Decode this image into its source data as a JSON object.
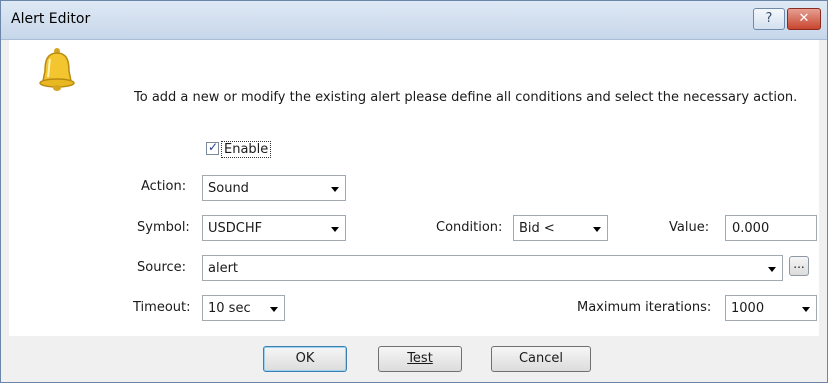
{
  "window": {
    "title": "Alert Editor",
    "help_label": "?",
    "close_label": "✕"
  },
  "intro": "To add a new or modify the existing alert please define all conditions and select the necessary action.",
  "enable": {
    "label": "Enable",
    "checked": true,
    "check_glyph": "✓"
  },
  "action": {
    "label": "Action:",
    "value": "Sound"
  },
  "symbol": {
    "label": "Symbol:",
    "value": "USDCHF"
  },
  "condition": {
    "label": "Condition:",
    "value": "Bid <"
  },
  "value_field": {
    "label": "Value:",
    "value": "0.000"
  },
  "source": {
    "label": "Source:",
    "value": "alert",
    "browse_label": "..."
  },
  "timeout": {
    "label": "Timeout:",
    "value": "10 sec"
  },
  "max_iterations": {
    "label": "Maximum iterations:",
    "value": "1000"
  },
  "buttons": {
    "ok": "OK",
    "test": "Test",
    "cancel": "Cancel"
  },
  "colors": {
    "bell": "#f3c52e",
    "title_bar": "#c6d6ea",
    "close": "#c8452f"
  },
  "icons": {
    "bell": "bell-icon"
  }
}
